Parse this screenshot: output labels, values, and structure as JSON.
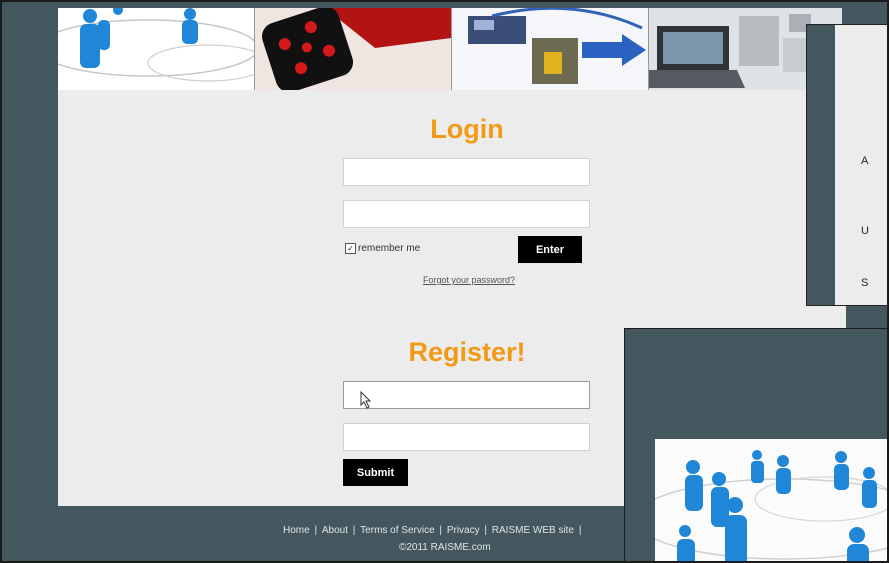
{
  "login": {
    "title": "Login",
    "username_value": "",
    "password_value": "",
    "remember_label": "remember me",
    "remember_checked_mark": "✓",
    "enter_label": "Enter",
    "forgot_label": "Forgot your password?"
  },
  "register": {
    "title": "Register!",
    "field1_value": "",
    "field2_value": "",
    "submit_label": "Submit"
  },
  "footer": {
    "links": [
      "Home",
      "About",
      "Terms of Service",
      "Privacy",
      "RAISME WEB site"
    ],
    "separator": "|",
    "copyright": "©2011 RAISME.com"
  },
  "side_window": {
    "letters": [
      "A",
      "U",
      "S"
    ]
  },
  "colors": {
    "accent": "#f29a16",
    "background": "#44575f",
    "panel": "#ececec",
    "button": "#000000"
  }
}
